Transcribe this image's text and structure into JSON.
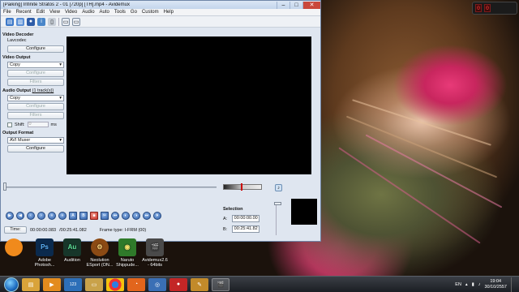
{
  "window": {
    "title": "[Paiking] Infinite Stratos 2 - 01 [720p] [TH].mp4 - Avidemux",
    "min": "–",
    "max": "□",
    "close": "✕"
  },
  "menu": [
    "File",
    "Recent",
    "Edit",
    "View",
    "Video",
    "Audio",
    "Auto",
    "Tools",
    "Go",
    "Custom",
    "Help"
  ],
  "panel": {
    "video_decoder": {
      "header": "Video Decoder",
      "codec": "Lavcodec",
      "configure": "Configure"
    },
    "video_output": {
      "header": "Video Output",
      "value": "Copy",
      "configure": "Configure",
      "filters": "Filters"
    },
    "audio_output": {
      "header": "Audio Output",
      "tracks": "(1 track(s))",
      "value": "Copy",
      "configure": "Configure",
      "filters": "Filters",
      "shift_label": "Shift:",
      "shift_value": "0",
      "shift_unit": "ms"
    },
    "output_format": {
      "header": "Output Format",
      "value": "AVI Muxer",
      "configure": "Configure"
    }
  },
  "selection": {
    "header": "Selection",
    "a_label": "A:",
    "a_value": "00:00:00.00",
    "b_label": "B:",
    "b_value": "00:25:41.82"
  },
  "timeline": {
    "time_button": "Time:",
    "current": "00:00:00.083",
    "total": "/00:25:41.082",
    "frame_type": "Frame type:  I-FRM (00)"
  },
  "volume_level": 0.45,
  "desktop_icons": [
    {
      "label": "",
      "icon": "orange-app-icon",
      "color": "#f08a1c"
    },
    {
      "label": "Adobe Photosh...",
      "icon": "photoshop-icon",
      "color": "#0b2a4d",
      "text": "Ps"
    },
    {
      "label": "Audition",
      "icon": "audition-icon",
      "color": "#2b5f38",
      "text": "Au"
    },
    {
      "label": "Neolution ESport (ON...",
      "icon": "neolution-icon",
      "color": "#8b4a14",
      "text": "⚙"
    },
    {
      "label": "Naruto Shippude...",
      "icon": "naruto-icon",
      "color": "#2f7a2a",
      "text": "◉"
    },
    {
      "label": "Avidemux2.6 - 64bits",
      "icon": "avidemux-icon",
      "color": "#4a4a4a",
      "text": "🎬"
    }
  ],
  "taskbar": {
    "apps": [
      "explorer-icon",
      "media-player-icon",
      "app-123-icon",
      "folder-icon",
      "chrome-icon",
      "firefox-icon",
      "messenger-icon",
      "stop-icon",
      "paint-icon",
      "avidemux-icon"
    ],
    "tray": {
      "lang": "EN",
      "time": "19:04",
      "date": "30/10/2557"
    }
  },
  "clock_gadget": [
    "0",
    "0"
  ]
}
